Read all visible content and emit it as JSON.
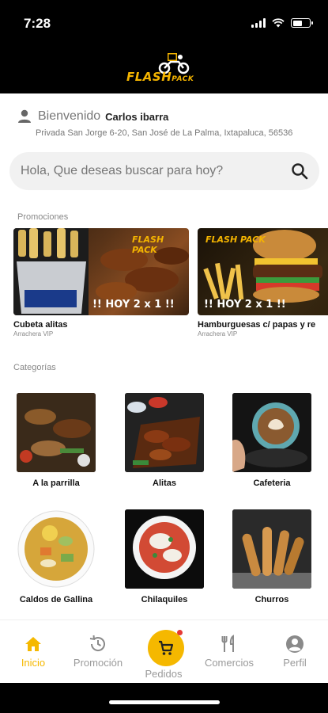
{
  "status": {
    "time": "7:28"
  },
  "header": {
    "logo_main": "FLASH",
    "logo_sub": "PACK"
  },
  "welcome": {
    "prefix": "Bienvenido",
    "name": "Carlos ibarra",
    "address": "Privada San Jorge 6-20,  San José de La Palma,  Ixtapaluca,  56536"
  },
  "search": {
    "placeholder": "Hola, Que deseas buscar para hoy?"
  },
  "promotions": {
    "label": "Promociones",
    "items": [
      {
        "title": "Cubeta alitas",
        "subtitle": "Arrachera VIP",
        "badge": "!! HOY 2 x 1 !!",
        "logo": "FLASH PACK"
      },
      {
        "title": "Hamburguesas c/ papas y re",
        "subtitle": "Arrachera VIP",
        "badge": "!! HOY 2 x 1 !!",
        "logo": "FLASH PACK"
      }
    ]
  },
  "categories": {
    "label": "Categorías",
    "items": [
      {
        "label": "A la parrilla"
      },
      {
        "label": "Alitas"
      },
      {
        "label": "Cafeteria"
      },
      {
        "label": "Caldos de Gallina"
      },
      {
        "label": "Chilaquiles"
      },
      {
        "label": "Churros"
      }
    ]
  },
  "nav": {
    "items": [
      {
        "label": "Inicio",
        "icon": "home-icon",
        "active": true
      },
      {
        "label": "Promoción",
        "icon": "history-icon"
      },
      {
        "label": "Pedidos",
        "icon": "cart-icon"
      },
      {
        "label": "Comercios",
        "icon": "restaurant-icon"
      },
      {
        "label": "Perfil",
        "icon": "profile-icon"
      }
    ]
  },
  "colors": {
    "accent": "#f5b800",
    "badge": "#e53935"
  }
}
